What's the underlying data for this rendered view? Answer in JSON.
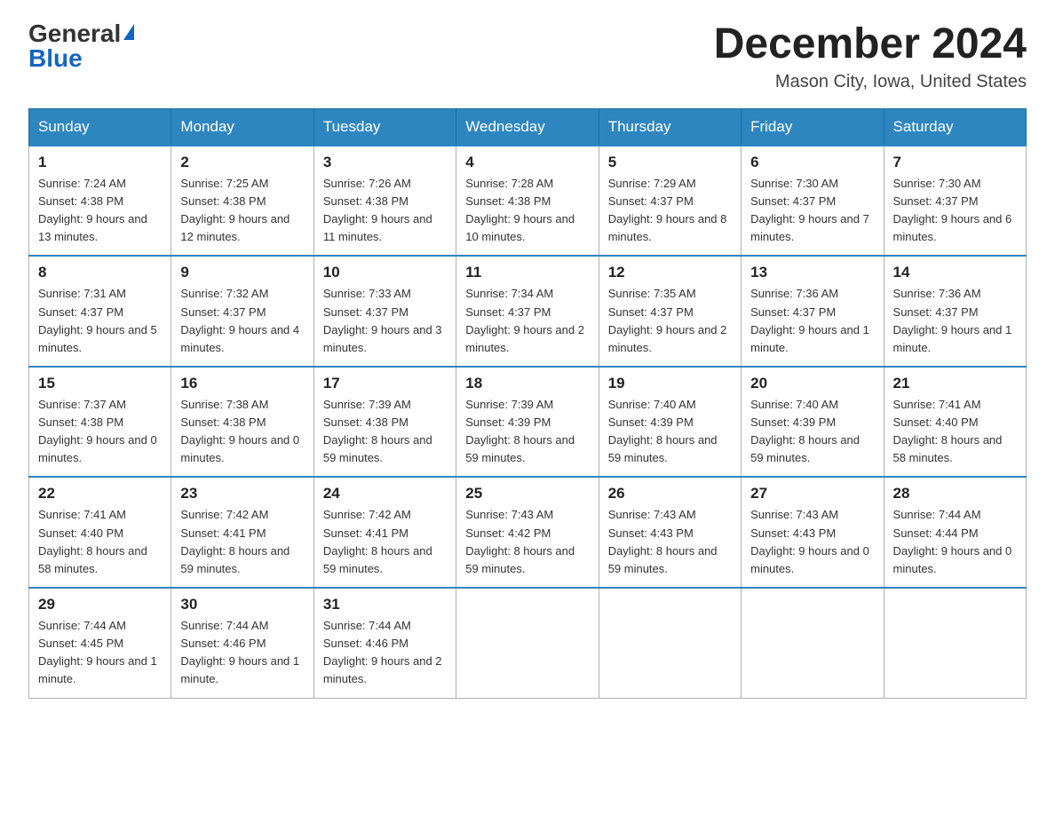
{
  "logo": {
    "general": "General",
    "blue": "Blue"
  },
  "header": {
    "month_year": "December 2024",
    "location": "Mason City, Iowa, United States"
  },
  "days_of_week": [
    "Sunday",
    "Monday",
    "Tuesday",
    "Wednesday",
    "Thursday",
    "Friday",
    "Saturday"
  ],
  "weeks": [
    [
      {
        "day": "1",
        "sunrise": "7:24 AM",
        "sunset": "4:38 PM",
        "daylight": "9 hours and 13 minutes."
      },
      {
        "day": "2",
        "sunrise": "7:25 AM",
        "sunset": "4:38 PM",
        "daylight": "9 hours and 12 minutes."
      },
      {
        "day": "3",
        "sunrise": "7:26 AM",
        "sunset": "4:38 PM",
        "daylight": "9 hours and 11 minutes."
      },
      {
        "day": "4",
        "sunrise": "7:28 AM",
        "sunset": "4:38 PM",
        "daylight": "9 hours and 10 minutes."
      },
      {
        "day": "5",
        "sunrise": "7:29 AM",
        "sunset": "4:37 PM",
        "daylight": "9 hours and 8 minutes."
      },
      {
        "day": "6",
        "sunrise": "7:30 AM",
        "sunset": "4:37 PM",
        "daylight": "9 hours and 7 minutes."
      },
      {
        "day": "7",
        "sunrise": "7:30 AM",
        "sunset": "4:37 PM",
        "daylight": "9 hours and 6 minutes."
      }
    ],
    [
      {
        "day": "8",
        "sunrise": "7:31 AM",
        "sunset": "4:37 PM",
        "daylight": "9 hours and 5 minutes."
      },
      {
        "day": "9",
        "sunrise": "7:32 AM",
        "sunset": "4:37 PM",
        "daylight": "9 hours and 4 minutes."
      },
      {
        "day": "10",
        "sunrise": "7:33 AM",
        "sunset": "4:37 PM",
        "daylight": "9 hours and 3 minutes."
      },
      {
        "day": "11",
        "sunrise": "7:34 AM",
        "sunset": "4:37 PM",
        "daylight": "9 hours and 2 minutes."
      },
      {
        "day": "12",
        "sunrise": "7:35 AM",
        "sunset": "4:37 PM",
        "daylight": "9 hours and 2 minutes."
      },
      {
        "day": "13",
        "sunrise": "7:36 AM",
        "sunset": "4:37 PM",
        "daylight": "9 hours and 1 minute."
      },
      {
        "day": "14",
        "sunrise": "7:36 AM",
        "sunset": "4:37 PM",
        "daylight": "9 hours and 1 minute."
      }
    ],
    [
      {
        "day": "15",
        "sunrise": "7:37 AM",
        "sunset": "4:38 PM",
        "daylight": "9 hours and 0 minutes."
      },
      {
        "day": "16",
        "sunrise": "7:38 AM",
        "sunset": "4:38 PM",
        "daylight": "9 hours and 0 minutes."
      },
      {
        "day": "17",
        "sunrise": "7:39 AM",
        "sunset": "4:38 PM",
        "daylight": "8 hours and 59 minutes."
      },
      {
        "day": "18",
        "sunrise": "7:39 AM",
        "sunset": "4:39 PM",
        "daylight": "8 hours and 59 minutes."
      },
      {
        "day": "19",
        "sunrise": "7:40 AM",
        "sunset": "4:39 PM",
        "daylight": "8 hours and 59 minutes."
      },
      {
        "day": "20",
        "sunrise": "7:40 AM",
        "sunset": "4:39 PM",
        "daylight": "8 hours and 59 minutes."
      },
      {
        "day": "21",
        "sunrise": "7:41 AM",
        "sunset": "4:40 PM",
        "daylight": "8 hours and 58 minutes."
      }
    ],
    [
      {
        "day": "22",
        "sunrise": "7:41 AM",
        "sunset": "4:40 PM",
        "daylight": "8 hours and 58 minutes."
      },
      {
        "day": "23",
        "sunrise": "7:42 AM",
        "sunset": "4:41 PM",
        "daylight": "8 hours and 59 minutes."
      },
      {
        "day": "24",
        "sunrise": "7:42 AM",
        "sunset": "4:41 PM",
        "daylight": "8 hours and 59 minutes."
      },
      {
        "day": "25",
        "sunrise": "7:43 AM",
        "sunset": "4:42 PM",
        "daylight": "8 hours and 59 minutes."
      },
      {
        "day": "26",
        "sunrise": "7:43 AM",
        "sunset": "4:43 PM",
        "daylight": "8 hours and 59 minutes."
      },
      {
        "day": "27",
        "sunrise": "7:43 AM",
        "sunset": "4:43 PM",
        "daylight": "9 hours and 0 minutes."
      },
      {
        "day": "28",
        "sunrise": "7:44 AM",
        "sunset": "4:44 PM",
        "daylight": "9 hours and 0 minutes."
      }
    ],
    [
      {
        "day": "29",
        "sunrise": "7:44 AM",
        "sunset": "4:45 PM",
        "daylight": "9 hours and 1 minute."
      },
      {
        "day": "30",
        "sunrise": "7:44 AM",
        "sunset": "4:46 PM",
        "daylight": "9 hours and 1 minute."
      },
      {
        "day": "31",
        "sunrise": "7:44 AM",
        "sunset": "4:46 PM",
        "daylight": "9 hours and 2 minutes."
      },
      null,
      null,
      null,
      null
    ]
  ]
}
